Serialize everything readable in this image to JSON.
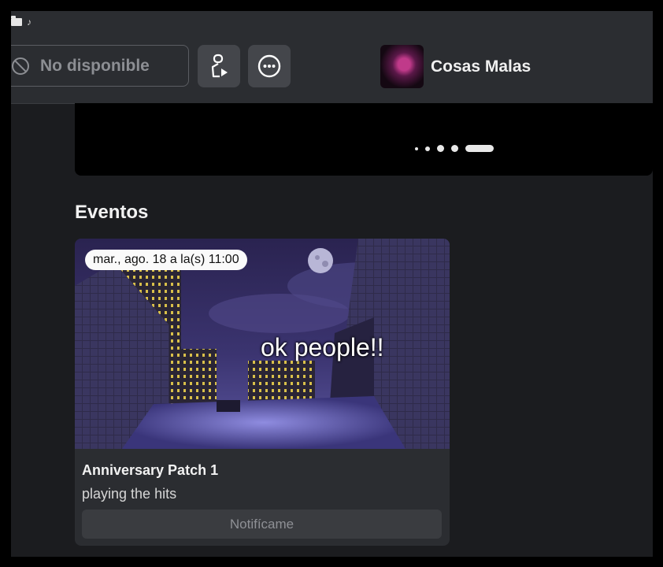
{
  "header": {
    "status_button": {
      "label": "No disponible",
      "icon": "ban-icon"
    },
    "party_button": {
      "icon": "person-play-icon"
    },
    "more_button": {
      "icon": "more-dots-icon"
    },
    "group": {
      "name": "Cosas Malas"
    }
  },
  "carousel": {
    "page_count": 5,
    "active_index": 4
  },
  "events_section": {
    "title": "Eventos",
    "events": [
      {
        "date": "mar., ago. 18 a la(s) 11:00",
        "overlay_text": "ok people!!",
        "title": "Anniversary Patch 1",
        "subtitle": "playing the hits",
        "notify_label": "Notifícame"
      }
    ]
  },
  "colors": {
    "background": "#1b1c1f",
    "topbar": "#2b2d31",
    "card": "#2b2d31",
    "button": "#44464b",
    "muted_text": "#8c8e93"
  }
}
